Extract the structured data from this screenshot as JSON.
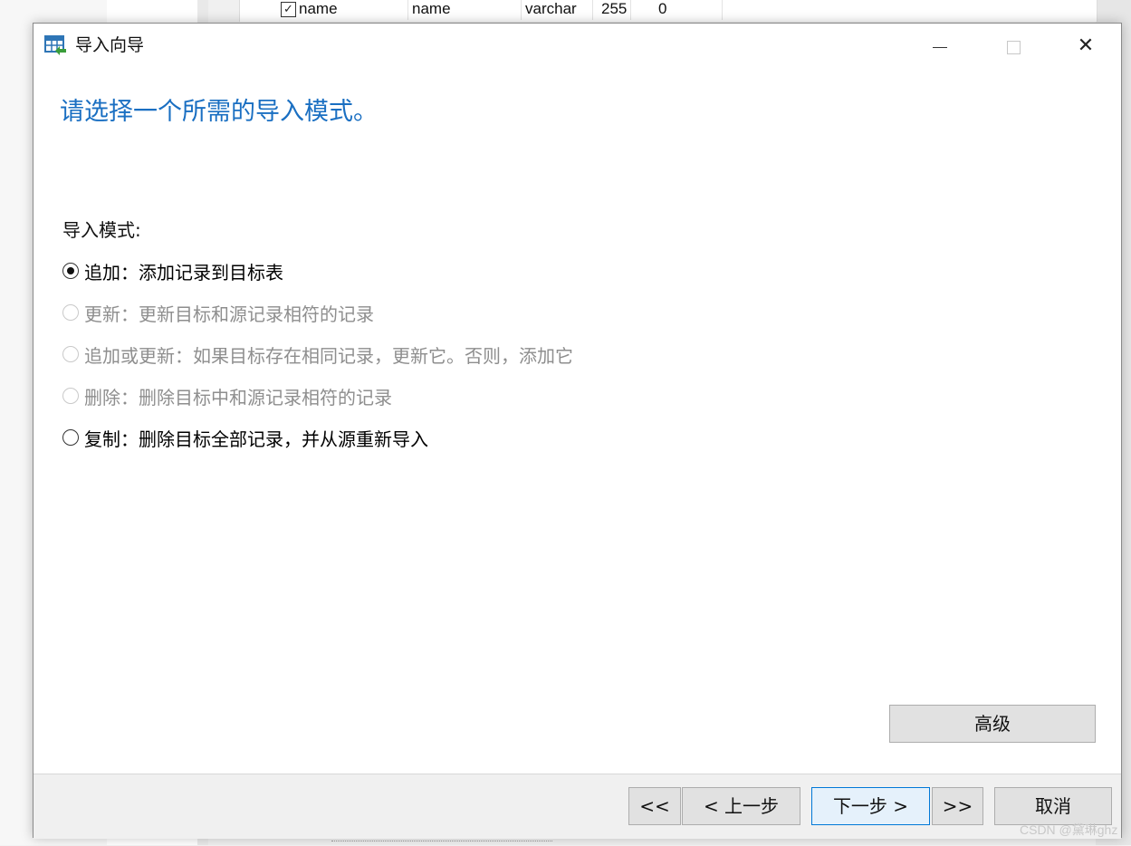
{
  "background": {
    "grid_row": {
      "checked": true,
      "cells": [
        "name",
        "name",
        "varchar",
        "255",
        "0"
      ]
    }
  },
  "dialog": {
    "title": "导入向导",
    "controls": {
      "minimize": "minimize",
      "maximize": "maximize",
      "close": "close"
    },
    "heading": "请选择一个所需的导入模式。",
    "mode_label": "导入模式:",
    "options": [
      {
        "label": "追加：添加记录到目标表",
        "selected": true,
        "enabled": true
      },
      {
        "label": "更新：更新目标和源记录相符的记录",
        "selected": false,
        "enabled": false
      },
      {
        "label": "追加或更新：如果目标存在相同记录，更新它。否则，添加它",
        "selected": false,
        "enabled": false
      },
      {
        "label": "删除：删除目标中和源记录相符的记录",
        "selected": false,
        "enabled": false
      },
      {
        "label": "复制：删除目标全部记录，并从源重新导入",
        "selected": false,
        "enabled": true
      }
    ],
    "advanced_button": "高级",
    "footer": {
      "first": "<<",
      "prev": "< 上一步",
      "next": "下一步 >",
      "last": ">>",
      "cancel": "取消"
    }
  },
  "watermark": "CSDN @黛琳ghz",
  "colors": {
    "heading": "#1a6fc2",
    "disabled_text": "#8e8e8e",
    "focused_button_border": "#0078d7"
  }
}
